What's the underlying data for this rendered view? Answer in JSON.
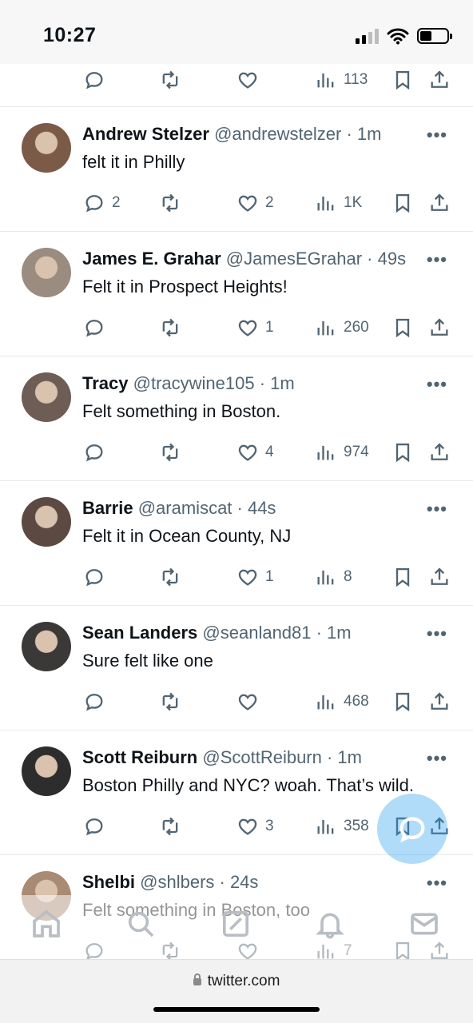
{
  "status_bar": {
    "time": "10:27"
  },
  "top_row": {
    "views": "113"
  },
  "tweets": [
    {
      "name": "Andrew Stelzer",
      "handle": "@andrewstelzer · 1m",
      "text": "felt it in Philly",
      "replies": "2",
      "retweets": "",
      "likes": "2",
      "views": "1K",
      "avatar_color": "#7b5a48"
    },
    {
      "name": "James E. Grahar",
      "handle": "@JamesEGrahar · 49s",
      "text": "Felt it in Prospect Heights!",
      "replies": "",
      "retweets": "",
      "likes": "1",
      "views": "260",
      "avatar_color": "#9b8c80"
    },
    {
      "name": "Tracy",
      "handle": "@tracywine105 · 1m",
      "text": "Felt something in Boston.",
      "replies": "",
      "retweets": "",
      "likes": "4",
      "views": "974",
      "avatar_color": "#6d5d55"
    },
    {
      "name": "Barrie",
      "handle": "@aramiscat · 44s",
      "text": "Felt it in Ocean County, NJ",
      "replies": "",
      "retweets": "",
      "likes": "1",
      "views": "8",
      "avatar_color": "#5c4a42"
    },
    {
      "name": "Sean Landers",
      "handle": "@seanland81 · 1m",
      "text": "Sure felt like one",
      "replies": "",
      "retweets": "",
      "likes": "",
      "views": "468",
      "avatar_color": "#3b3838"
    },
    {
      "name": "Scott Reiburn",
      "handle": "@ScottReiburn · 1m",
      "text": "Boston Philly and NYC? woah. That’s wild.",
      "replies": "",
      "retweets": "",
      "likes": "3",
      "views": "358",
      "avatar_color": "#2d2d2d"
    },
    {
      "name": "Shelbi",
      "handle": "@shlbers · 24s",
      "text": "Felt something in Boston, too",
      "replies": "",
      "retweets": "",
      "likes": "",
      "views": "7",
      "avatar_color": "#a98a72"
    }
  ],
  "browser": {
    "url": "twitter.com"
  },
  "icons": {
    "reply": "reply-icon",
    "retweet": "retweet-icon",
    "like": "heart-icon",
    "views": "views-icon",
    "bookmark": "bookmark-icon",
    "share": "share-icon",
    "more": "more-icon",
    "nav": [
      "home-icon",
      "search-icon",
      "communities-icon",
      "notifications-icon",
      "messages-icon"
    ],
    "fab": "compose-icon"
  },
  "colors": {
    "accent": "#1d9bf0",
    "secondary_text": "#536471",
    "divider": "#e6e9ec"
  }
}
